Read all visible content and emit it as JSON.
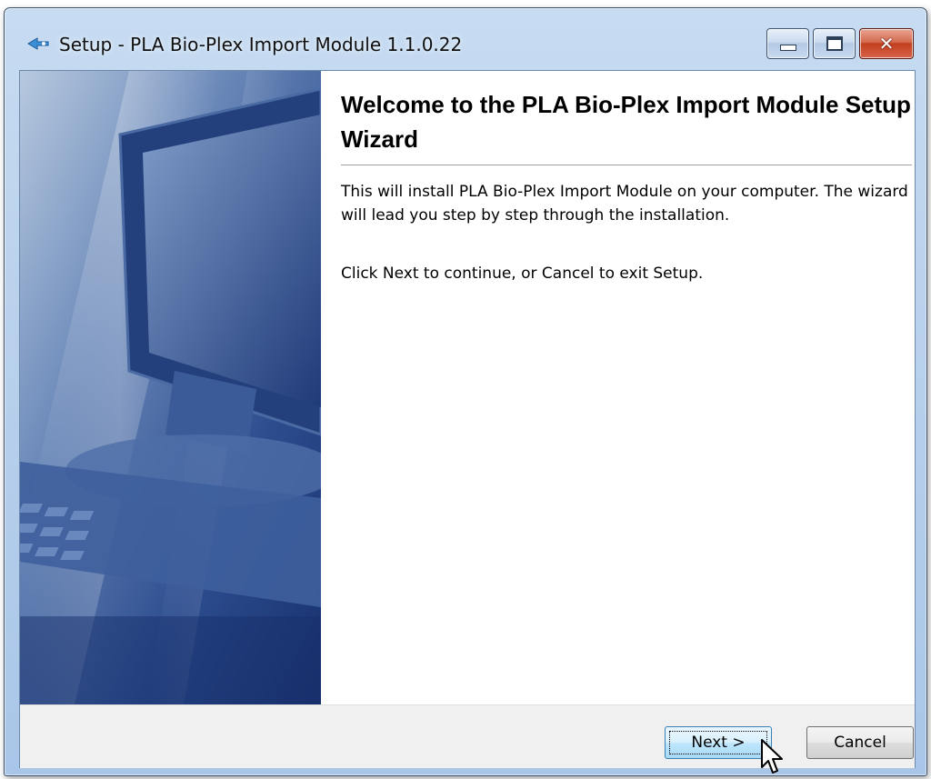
{
  "window": {
    "title": "Setup - PLA Bio-Plex Import Module 1.1.0.22",
    "icon": "installer-arrow-icon",
    "caption_buttons": [
      {
        "name": "minimize",
        "icon": "minimize-icon"
      },
      {
        "name": "maximize",
        "icon": "maximize-icon"
      },
      {
        "name": "close",
        "icon": "close-icon",
        "color": "#c2401f"
      }
    ]
  },
  "wizard": {
    "heading": "Welcome to the PLA Bio-Plex Import Module Setup Wizard",
    "paragraph1": "This will install PLA Bio-Plex Import Module on your computer. The wizard will lead you step by step through the installation.",
    "paragraph2": "Click Next to continue, or Cancel to exit Setup.",
    "side_image": "computer-monitor-keyboard-image"
  },
  "buttons": {
    "next_label": "Next >",
    "cancel_label": "Cancel"
  },
  "colors": {
    "side_image_accent": "#2e4f90",
    "next_button_border": "#3c7fb1"
  }
}
